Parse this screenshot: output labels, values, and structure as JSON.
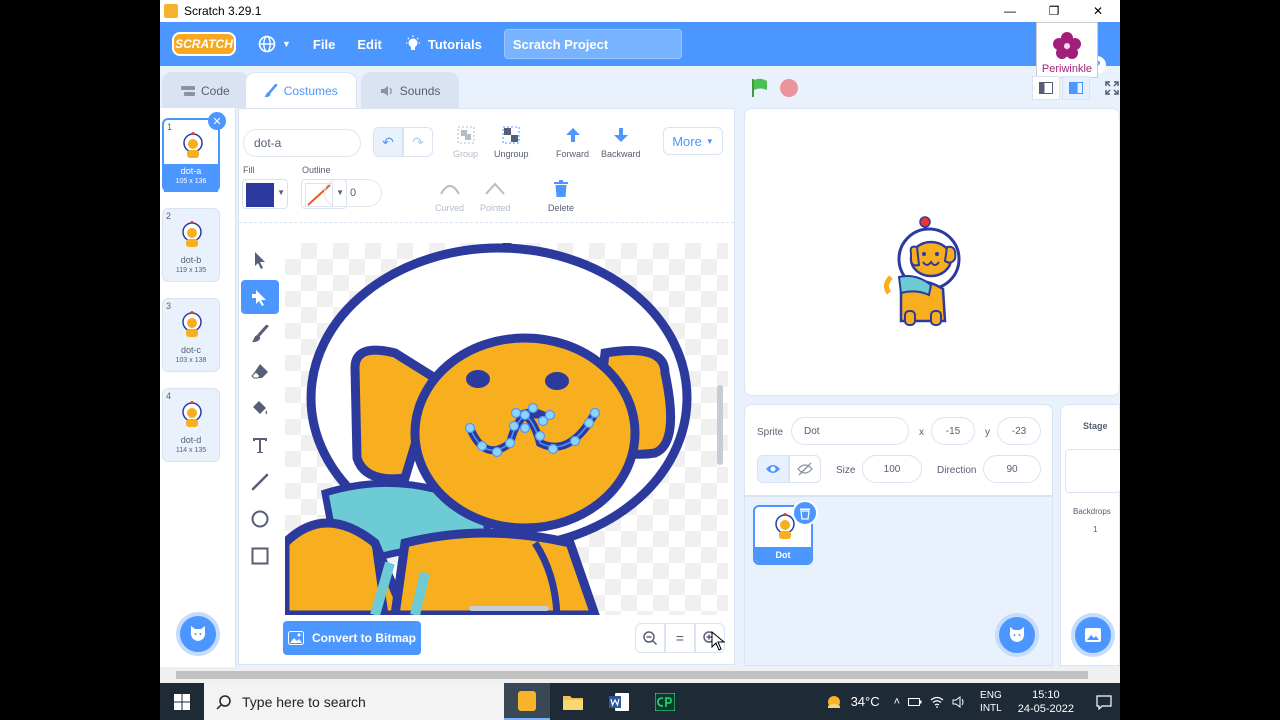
{
  "window": {
    "title": "Scratch 3.29.1"
  },
  "menubar": {
    "logo": "SCRATCH",
    "file": "File",
    "edit": "Edit",
    "tutorials": "Tutorials",
    "project_title": "Scratch Project",
    "help": "?"
  },
  "badge": {
    "label": "Periwinkle"
  },
  "tabs": [
    {
      "label": "Code"
    },
    {
      "label": "Costumes",
      "active": true
    },
    {
      "label": "Sounds"
    }
  ],
  "costumes": [
    {
      "num": "1",
      "name": "dot-a",
      "size": "105 x 136",
      "selected": true
    },
    {
      "num": "2",
      "name": "dot-b",
      "size": "119 x 135"
    },
    {
      "num": "3",
      "name": "dot-c",
      "size": "103 x 138"
    },
    {
      "num": "4",
      "name": "dot-d",
      "size": "114 x 135"
    }
  ],
  "editor": {
    "costume_name": "dot-a",
    "group": "Group",
    "ungroup": "Ungroup",
    "forward": "Forward",
    "backward": "Backward",
    "more": "More",
    "fill_label": "Fill",
    "outline_label": "Outline",
    "fill_color": "#2c3a9e",
    "outline_width": "0",
    "curved": "Curved",
    "pointed": "Pointed",
    "delete": "Delete",
    "convert": "Convert to Bitmap",
    "zoom_reset": "="
  },
  "sprite_info": {
    "sprite_label": "Sprite",
    "sprite_name": "Dot",
    "x_label": "x",
    "x_value": "-15",
    "y_label": "y",
    "y_value": "-23",
    "size_label": "Size",
    "size_value": "100",
    "direction_label": "Direction",
    "direction_value": "90"
  },
  "sprite_tile": {
    "name": "Dot"
  },
  "stage_pane": {
    "title": "Stage",
    "backdrops_label": "Backdrops",
    "backdrops_count": "1"
  },
  "taskbar": {
    "search_placeholder": "Type here to search",
    "weather": "34°C",
    "lang_top": "ENG",
    "lang_bottom": "INTL",
    "time": "15:10",
    "date": "24-05-2022"
  },
  "colors": {
    "accent": "#4c97ff",
    "dog_orange": "#f7ae1f",
    "outline_blue": "#2c3a9e",
    "scarf": "#6ccbd4"
  }
}
